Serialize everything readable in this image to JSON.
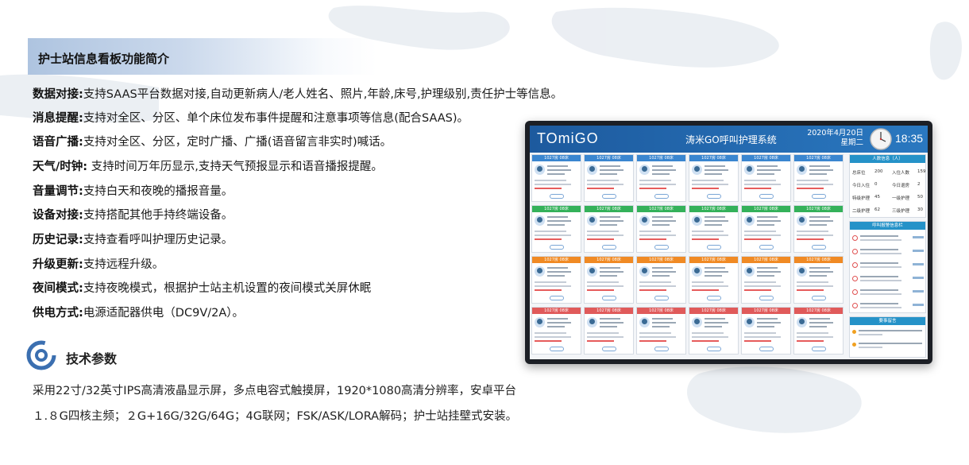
{
  "banner": {
    "title": "护士站信息看板功能简介"
  },
  "features": [
    {
      "label": "数据对接:",
      "text": "支持SAAS平台数据对接,自动更新病人/老人姓名、照片,年龄,床号,护理级别,责任护士等信息。"
    },
    {
      "label": "消息提醒:",
      "text": "支持对全区、分区、单个床位发布事件提醒和注意事项等信息(配合SAAS)。"
    },
    {
      "label": "语音广播:",
      "text": "支持对全区、分区，定时广播、广播(语音留言非实时)喊话。"
    },
    {
      "label": "天气/时钟:",
      "text": "  支持时间万年历显示,支持天气预报显示和语音播报提醒。"
    },
    {
      "label": "音量调节:",
      "text": "支持白天和夜晚的播报音量。"
    },
    {
      "label": "设备对接:",
      "text": "支持搭配其他手持终端设备。"
    },
    {
      "label": "历史记录:",
      "text": "支持查看呼叫护理历史记录。"
    },
    {
      "label": "升级更新:",
      "text": "支持远程升级。"
    },
    {
      "label": "夜间模式:",
      "text": "支持夜晚模式，根据护士站主机设置的夜间模式关屏休眠"
    },
    {
      "label": "供电方式:",
      "text": "电源适配器供电（DC9V/2A）。"
    }
  ],
  "tech": {
    "title": "技术参数",
    "lines": [
      "采用22寸/32英寸IPS高清液晶显示屏，多点电容式触摸屏，1920*1080高清分辨率，安卓平台",
      "１.８G四核主频；２G+16G/32G/64G；4G联网；FSK/ASK/LORA解码；护士站挂壁式安装。"
    ]
  },
  "screen": {
    "logo": "TOmiGO",
    "system_title": "涛米GO呼叫护理系统",
    "date": "2020年4月20日",
    "weekday": "星期二",
    "time": "18:35",
    "card_room": "1027房",
    "card_bed": "08床",
    "row_colors": [
      "#3a86d0",
      "#34b15a",
      "#f08a24",
      "#e05a5a"
    ],
    "side_titles": [
      "人数信息（人）",
      "呼叫报警信息栏",
      "要事留言"
    ],
    "stats": [
      {
        "label": "总床位",
        "value": "200",
        "label2": "入住人数",
        "value2": "159"
      },
      {
        "label": "今日入住",
        "value": "0",
        "label2": "今日退房",
        "value2": "2"
      },
      {
        "label": "特级护理",
        "value": "45",
        "label2": "一级护理",
        "value2": "50"
      },
      {
        "label": "二级护理",
        "value": "62",
        "label2": "三级护理",
        "value2": "30"
      }
    ]
  }
}
